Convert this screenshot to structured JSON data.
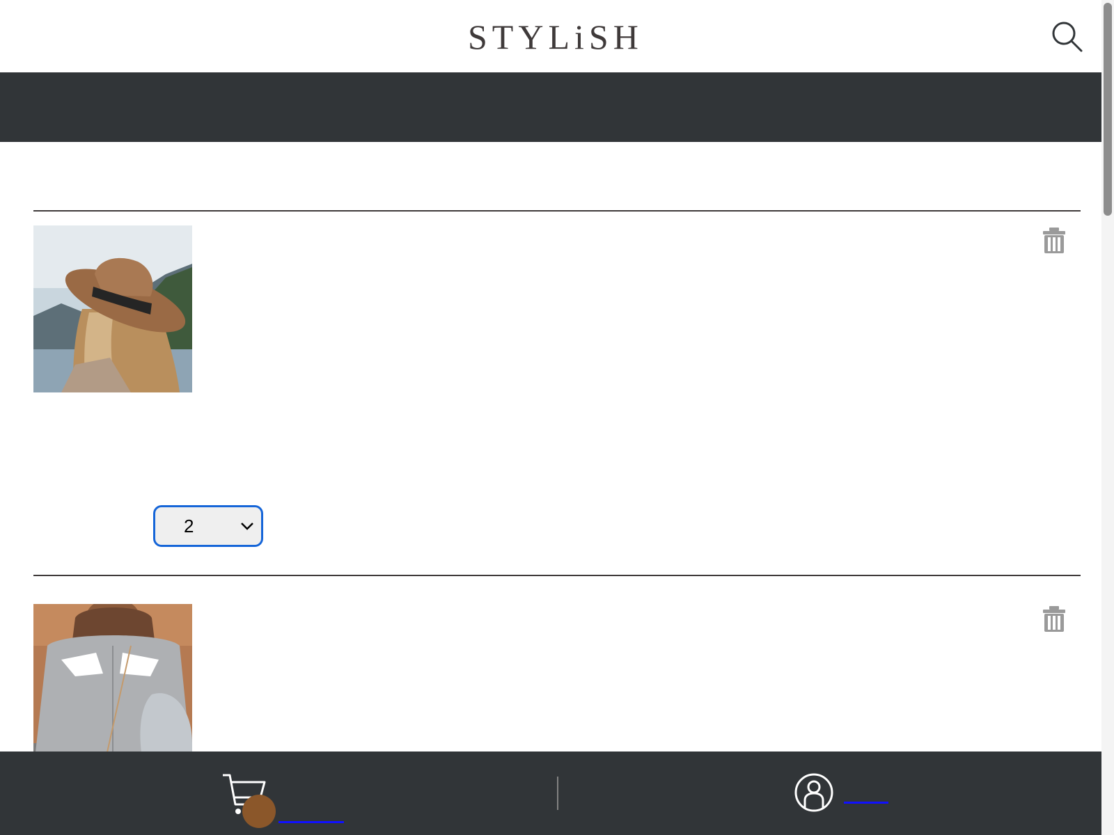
{
  "header": {
    "logo_text": "STYLiSH",
    "search_icon": "search-icon"
  },
  "cart": {
    "items": [
      {
        "photo": "woman-brown-hat-photo",
        "quantity": "2",
        "remove_icon": "trash-icon"
      },
      {
        "photo": "woman-grey-shirt-photo",
        "remove_icon": "trash-icon"
      }
    ]
  },
  "bottom_nav": {
    "cart_icon": "cart-icon",
    "member_icon": "member-icon"
  },
  "colors": {
    "nav_background": "#313538",
    "logo_text": "#3f3a3a",
    "badge": "#8b572a",
    "focus_ring": "#1565d8",
    "link_underline": "#1010ff"
  }
}
